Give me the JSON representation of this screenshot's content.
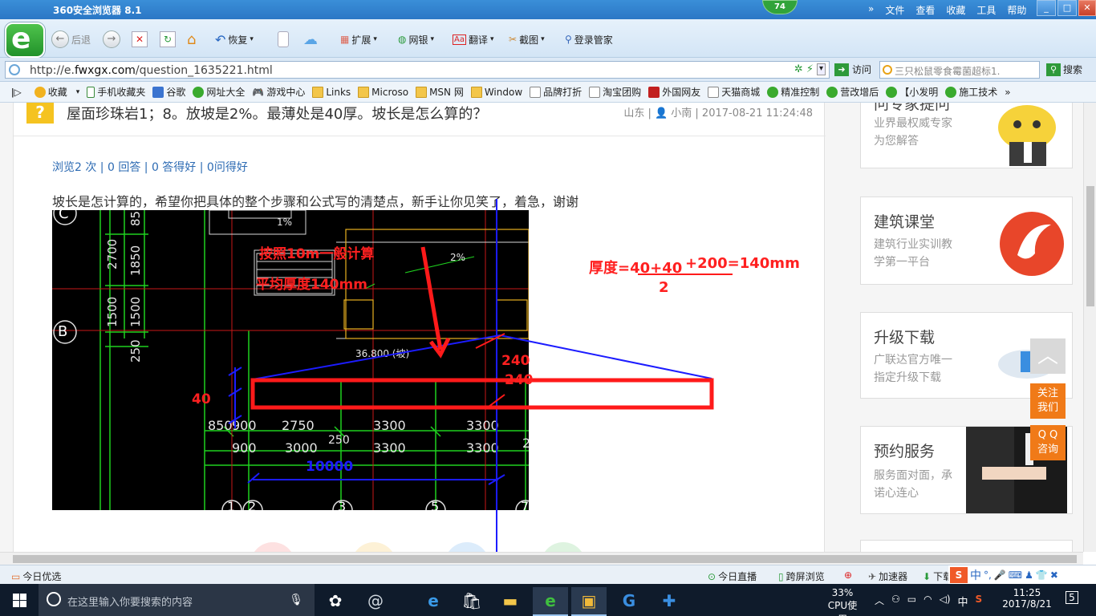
{
  "browser": {
    "title": "360安全浏览器 8.1",
    "badge": "74",
    "menu": [
      "文件",
      "查看",
      "收藏",
      "工具",
      "帮助"
    ],
    "win_buttons": {
      "min": "_",
      "max": "□",
      "close": "✕"
    }
  },
  "toolbar": {
    "back": "后退",
    "restore": "恢复",
    "extend": "扩展",
    "netbank": "网银",
    "translate": "翻译",
    "screenshot": "截图",
    "login_manager": "登录管家"
  },
  "address": {
    "url_prefix": "http://e.",
    "url_domain": "fwxgx.com",
    "url_path": "/question_1635221.html",
    "visit": "访问",
    "search_placeholder": "三只松鼠零食霉菌超标1.",
    "search": "搜索"
  },
  "favorites": [
    "收藏",
    "手机收藏夹",
    "谷歌",
    "网址大全",
    "游戏中心",
    "Links",
    "Microso",
    "MSN 网",
    "Window",
    "品牌打折",
    "淘宝团购",
    "外国网友",
    "天猫商城",
    "精准控制",
    "营改增后",
    "【小发明",
    "施工技术"
  ],
  "question": {
    "title": "屋面珍珠岩1；8。放坡是2%。最薄处是40厚。坡长是怎么算的？",
    "meta": "山东 | 👤 小南 | 2017-08-21 11:24:48",
    "stats": "浏览2 次 | 0 回答 | 0 答得好 | 0问得好",
    "description": "坡长是怎计算的，希望你把具体的整个步骤和公式写的清楚点，新手让你见笑了，着急，谢谢"
  },
  "cad": {
    "annot_general": "按照10m一般计算",
    "annot_avg": "平均厚度140mm",
    "slope": "2%",
    "slope_small": "1%",
    "elevation": "36.800 (坡)",
    "axis_c": "C",
    "axis_b": "B",
    "dims_left": [
      "850",
      "1850",
      "2700",
      "1500",
      "1500",
      "250"
    ],
    "dims_row1": [
      "850",
      "900",
      "2750",
      "3300",
      "3300"
    ],
    "dims_row2": [
      "900",
      "3000",
      "250",
      "3300",
      "3300",
      "2"
    ],
    "axis_nums": [
      "1",
      "2",
      "3",
      "5",
      "7"
    ],
    "span": "10000",
    "thick_40": "40",
    "thick_240a": "240",
    "thick_240b": "240",
    "formula_main": "厚度=40+40",
    "formula_rest": "+200=140mm",
    "formula_den": "2"
  },
  "sidebar": [
    {
      "title": "问专家提问",
      "sub1": "业界最权威专家",
      "sub2": "为您解答"
    },
    {
      "title": "建筑课堂",
      "sub1": "建筑行业实训教",
      "sub2": "学第一平台"
    },
    {
      "title": "升级下载",
      "sub1": "广联达官方唯一",
      "sub2": "指定升级下载"
    },
    {
      "title": "预约服务",
      "sub1": "服务面对面，承",
      "sub2": "诺心连心"
    }
  ],
  "floats": {
    "follow": "关注我们",
    "follow1": "关注",
    "follow2": "我们",
    "qq1": "Q Q",
    "qq2": "咨询",
    "top": "︿"
  },
  "statusbar": {
    "left": "今日优选",
    "live": "今日直播",
    "cross": "跨屏浏览",
    "accel": "加速器",
    "download": "下载",
    "ime": "中"
  },
  "taskbar": {
    "search_placeholder": "在这里输入你要搜索的内容",
    "cpu_pct": "33%",
    "cpu_label": "CPU使用",
    "ime": "中",
    "time": "11:25",
    "date": "2017/8/21",
    "notif": "5"
  },
  "colors": {
    "accent": "#2b77c5",
    "cad_red": "#ff1a1a",
    "cad_blue": "#1c1cff",
    "cad_green": "#1fd11f"
  }
}
